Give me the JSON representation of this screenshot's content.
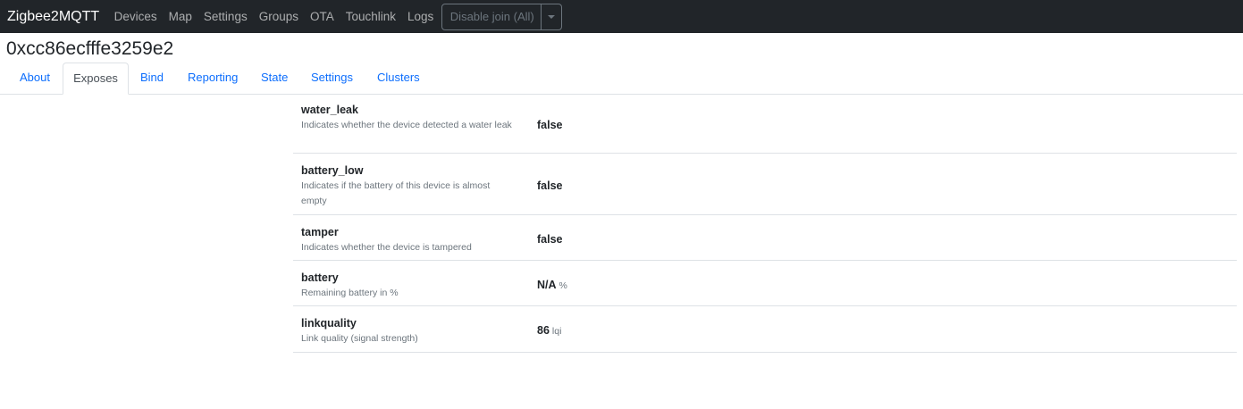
{
  "navbar": {
    "brand": "Zigbee2MQTT",
    "links": [
      "Devices",
      "Map",
      "Settings",
      "Groups",
      "OTA",
      "Touchlink",
      "Logs"
    ],
    "join_button": "Disable join (All)"
  },
  "page": {
    "title": "0xcc86ecfffe3259e2"
  },
  "tabs": [
    "About",
    "Exposes",
    "Bind",
    "Reporting",
    "State",
    "Settings",
    "Clusters"
  ],
  "active_tab": "Exposes",
  "exposes": [
    {
      "name": "water_leak",
      "description": "Indicates whether the device detected a water leak",
      "value": "false",
      "unit": ""
    },
    {
      "name": "battery_low",
      "description": "Indicates if the battery of this device is almost empty",
      "value": "false",
      "unit": ""
    },
    {
      "name": "tamper",
      "description": "Indicates whether the device is tampered",
      "value": "false",
      "unit": ""
    },
    {
      "name": "battery",
      "description": "Remaining battery in %",
      "value": "N/A",
      "unit": "%"
    },
    {
      "name": "linkquality",
      "description": "Link quality (signal strength)",
      "value": "86",
      "unit": "lqi"
    }
  ],
  "colors": {
    "navbar_bg": "#212529",
    "link": "#0d6efd",
    "muted": "#6c757d",
    "border": "#dee2e6"
  }
}
